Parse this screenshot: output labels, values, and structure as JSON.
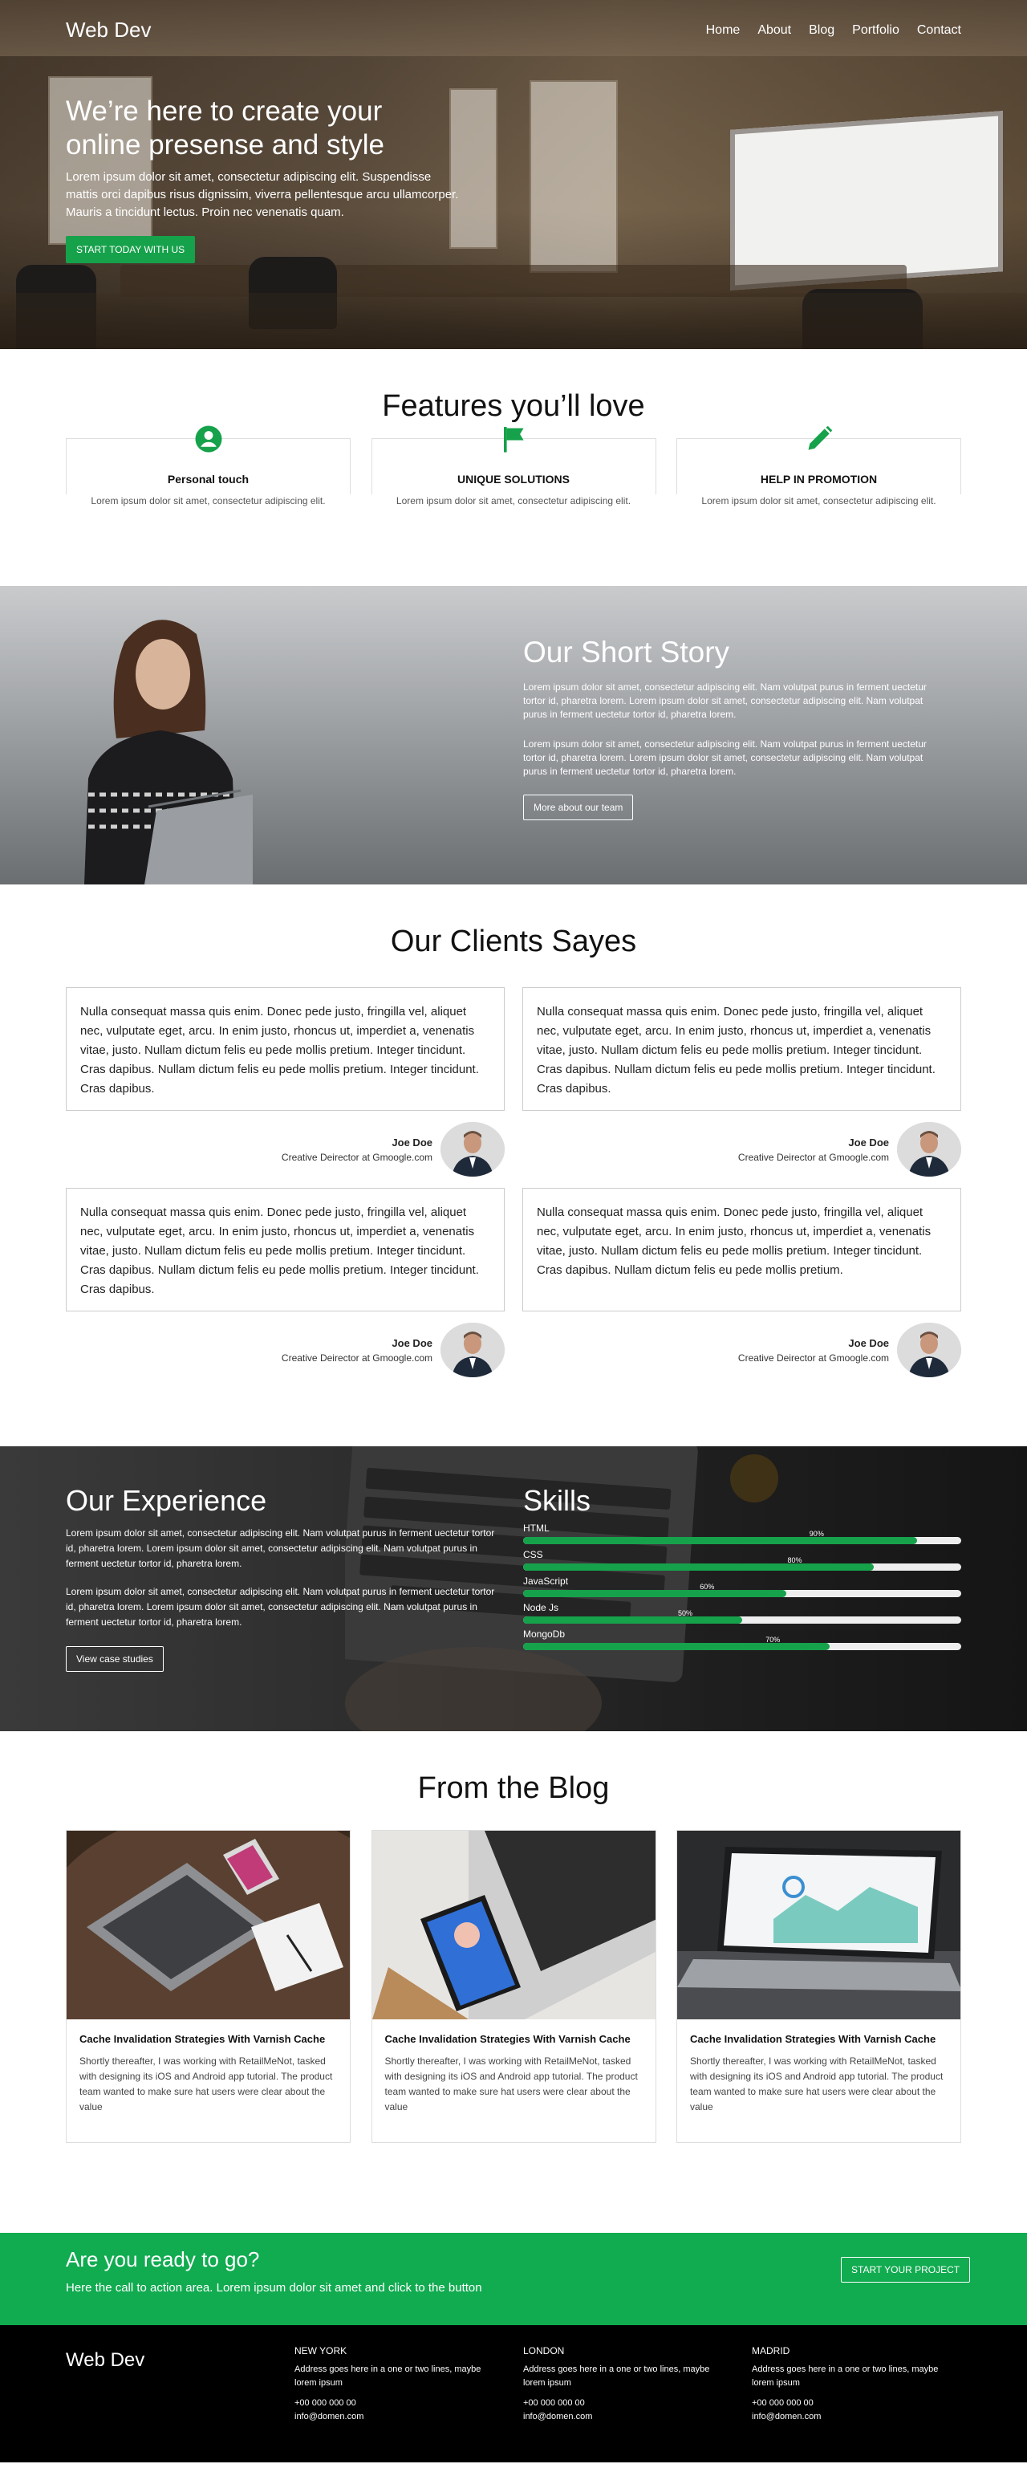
{
  "nav": {
    "brand": "Web Dev",
    "links": [
      "Home",
      "About",
      "Blog",
      "Portfolio",
      "Contact"
    ]
  },
  "hero": {
    "title": "We’re here to create your online presense and style",
    "text": "Lorem ipsum dolor sit amet, consectetur adipiscing elit. Suspendisse mattis orci dapibus risus dignissim, viverra pellentesque arcu ullamcorper. Mauris a tincidunt lectus. Proin nec venenatis quam.",
    "cta": "START TODAY WITH US"
  },
  "features": {
    "title": "Features you’ll love",
    "items": [
      {
        "icon": "user-circle-icon",
        "title": "Personal touch",
        "text": "Lorem ipsum dolor sit amet, consectetur adipiscing elit."
      },
      {
        "icon": "flag-icon",
        "title": "UNIQUE SOLUTIONS",
        "text": "Lorem ipsum dolor sit amet, consectetur adipiscing elit."
      },
      {
        "icon": "pencil-icon",
        "title": "HELP IN PROMOTION",
        "text": "Lorem ipsum dolor sit amet, consectetur adipiscing elit."
      }
    ]
  },
  "story": {
    "title": "Our Short Story",
    "p1": "Lorem ipsum dolor sit amet, consectetur adipiscing elit. Nam volutpat purus in ferment uectetur tortor id, pharetra lorem. Lorem ipsum dolor sit amet, consectetur adipiscing elit. Nam volutpat purus in ferment uectetur tortor id, pharetra lorem.",
    "p2": "Lorem ipsum dolor sit amet, consectetur adipiscing elit. Nam volutpat purus in ferment uectetur tortor id, pharetra lorem. Lorem ipsum dolor sit amet, consectetur adipiscing elit. Nam volutpat purus in ferment uectetur tortor id, pharetra lorem.",
    "button": "More about our team"
  },
  "clients": {
    "title": "Our Clients Sayes",
    "items": [
      {
        "quote": "Nulla consequat massa quis enim. Donec pede justo, fringilla vel, aliquet nec, vulputate eget, arcu. In enim justo, rhoncus ut, imperdiet a, venenatis vitae, justo. Nullam dictum felis eu pede mollis pretium. Integer tincidunt. Cras dapibus. Nullam dictum felis eu pede mollis pretium. Integer tincidunt. Cras dapibus.",
        "name": "Joe Doe",
        "role": "Creative Deirector at Gmoogle.com"
      },
      {
        "quote": "Nulla consequat massa quis enim. Donec pede justo, fringilla vel, aliquet nec, vulputate eget, arcu. In enim justo, rhoncus ut, imperdiet a, venenatis vitae, justo. Nullam dictum felis eu pede mollis pretium. Integer tincidunt. Cras dapibus. Nullam dictum felis eu pede mollis pretium. Integer tincidunt. Cras dapibus.",
        "name": "Joe Doe",
        "role": "Creative Deirector at Gmoogle.com"
      },
      {
        "quote": "Nulla consequat massa quis enim. Donec pede justo, fringilla vel, aliquet nec, vulputate eget, arcu. In enim justo, rhoncus ut, imperdiet a, venenatis vitae, justo. Nullam dictum felis eu pede mollis pretium. Integer tincidunt. Cras dapibus. Nullam dictum felis eu pede mollis pretium. Integer tincidunt. Cras dapibus.",
        "name": "Joe Doe",
        "role": "Creative Deirector at Gmoogle.com"
      },
      {
        "quote": "Nulla consequat massa quis enim. Donec pede justo, fringilla vel, aliquet nec, vulputate eget, arcu. In enim justo, rhoncus ut, imperdiet a, venenatis vitae, justo. Nullam dictum felis eu pede mollis pretium. Integer tincidunt. Cras dapibus. Nullam dictum felis eu pede mollis pretium.",
        "name": "Joe Doe",
        "role": "Creative Deirector at Gmoogle.com"
      }
    ]
  },
  "experience": {
    "title": "Our Experience",
    "p1": "Lorem ipsum dolor sit amet, consectetur adipiscing elit. Nam volutpat purus in ferment uectetur tortor id, pharetra lorem. Lorem ipsum dolor sit amet, consectetur adipiscing elit. Nam volutpat purus in ferment uectetur tortor id, pharetra lorem.",
    "p2": "Lorem ipsum dolor sit amet, consectetur adipiscing elit. Nam volutpat purus in ferment uectetur tortor id, pharetra lorem. Lorem ipsum dolor sit amet, consectetur adipiscing elit. Nam volutpat purus in ferment uectetur tortor id, pharetra lorem.",
    "button": "View case studies"
  },
  "skills": {
    "title": "Skills",
    "items": [
      {
        "name": "HTML",
        "value": 90,
        "label": "90%"
      },
      {
        "name": "CSS",
        "value": 80,
        "label": "80%"
      },
      {
        "name": "JavaScript",
        "value": 60,
        "label": "60%"
      },
      {
        "name": "Node Js",
        "value": 50,
        "label": "50%"
      },
      {
        "name": "MongoDb",
        "value": 70,
        "label": "70%"
      }
    ]
  },
  "blog": {
    "title": "From the Blog",
    "posts": [
      {
        "title": "Cache Invalidation Strategies With Varnish Cache",
        "excerpt": "Shortly thereafter, I was working with RetailMeNot, tasked with designing its iOS and Android app tutorial. The product team wanted to make sure hat users were clear about the value"
      },
      {
        "title": "Cache Invalidation Strategies With Varnish Cache",
        "excerpt": "Shortly thereafter, I was working with RetailMeNot, tasked with designing its iOS and Android app tutorial. The product team wanted to make sure hat users were clear about the value"
      },
      {
        "title": "Cache Invalidation Strategies With Varnish Cache",
        "excerpt": "Shortly thereafter, I was working with RetailMeNot, tasked with designing its iOS and Android app tutorial. The product team wanted to make sure hat users were clear about the value"
      }
    ]
  },
  "cta": {
    "title": "Are you ready to go?",
    "text": "Here the call to action area. Lorem ipsum dolor sit amet and click to the button",
    "button": "START YOUR PROJECT"
  },
  "footer": {
    "brand": "Web Dev",
    "offices": [
      {
        "city": "NEW YORK",
        "address": "Address goes here in a one or two lines, maybe lorem ipsum",
        "phone": "+00 000 000 00",
        "email": "info@domen.com"
      },
      {
        "city": "LONDON",
        "address": "Address goes here in a one or two lines, maybe lorem ipsum",
        "phone": "+00 000 000 00",
        "email": "info@domen.com"
      },
      {
        "city": "MADRID",
        "address": "Address goes here in a one or two lines, maybe lorem ipsum",
        "phone": "+00 000 000 00",
        "email": "info@domen.com"
      }
    ]
  },
  "colors": {
    "accent": "#16a14b",
    "cta_bg": "#11ab50",
    "footer_bg": "#000000"
  }
}
